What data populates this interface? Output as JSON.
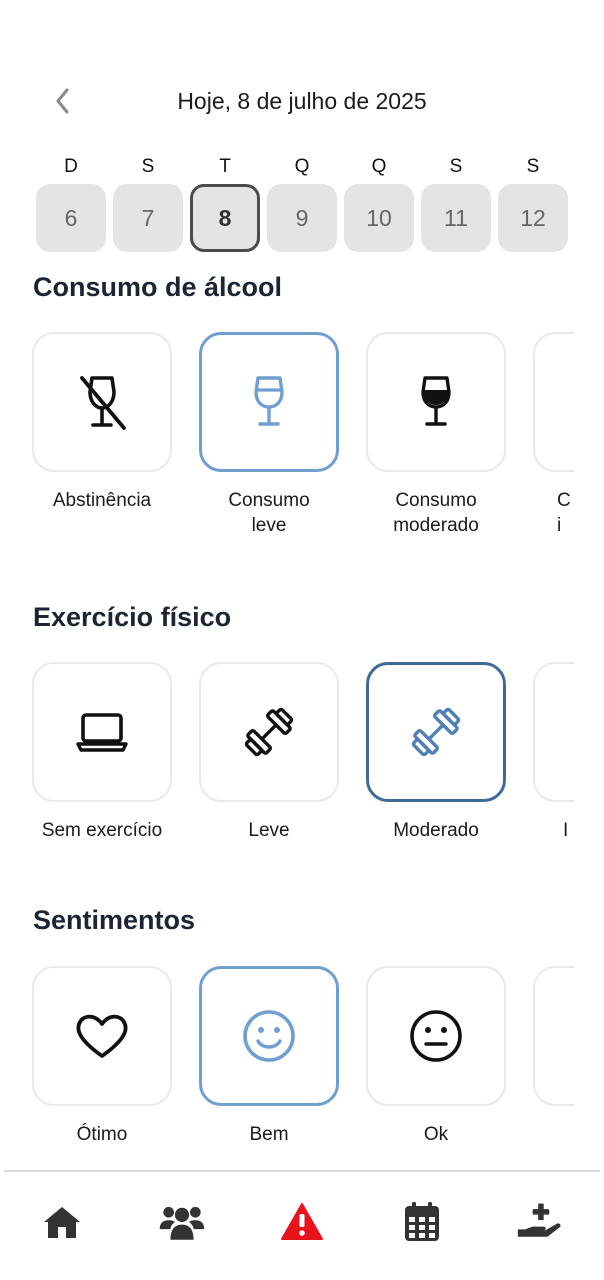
{
  "header": {
    "title": "Hoje, 8 de julho de 2025",
    "back_icon": "chevron-left-icon"
  },
  "week": {
    "letters": [
      "D",
      "S",
      "T",
      "Q",
      "Q",
      "S",
      "S"
    ],
    "days": [
      "6",
      "7",
      "8",
      "9",
      "10",
      "11",
      "12"
    ],
    "selected_index": 2
  },
  "alcohol": {
    "title": "Consumo de álcool",
    "options": [
      {
        "label": "Abstinência",
        "icon": "wine-glass-off-icon"
      },
      {
        "label": "Consumo\nleve",
        "icon": "wine-glass-icon",
        "selected": true
      },
      {
        "label": "Consumo\nmoderado",
        "icon": "wine-glass-icon"
      },
      {
        "label": "C\ni",
        "icon": ""
      }
    ]
  },
  "exercise": {
    "title": "Exercício físico",
    "options": [
      {
        "label": "Sem exercício",
        "icon": "laptop-icon"
      },
      {
        "label": "Leve",
        "icon": "dumbbell-icon"
      },
      {
        "label": "Moderado",
        "icon": "dumbbell-icon",
        "selected": true
      },
      {
        "label": "I",
        "icon": ""
      }
    ]
  },
  "feelings": {
    "title": "Sentimentos",
    "options": [
      {
        "label": "Ótimo",
        "icon": "heart-icon"
      },
      {
        "label": "Bem",
        "icon": "smile-icon",
        "selected": true
      },
      {
        "label": "Ok",
        "icon": "neutral-face-icon"
      },
      {
        "label": "",
        "icon": ""
      }
    ]
  },
  "nav": {
    "items": [
      "home-icon",
      "users-icon",
      "alert-icon",
      "calendar-icon",
      "hand-medical-icon"
    ],
    "active_color": "#e8141c",
    "icon_color": "#333333"
  },
  "colors": {
    "selected_light": "#6f9fd0",
    "selected_dark": "#3f6a98",
    "day_bg": "#e4e4e4"
  }
}
